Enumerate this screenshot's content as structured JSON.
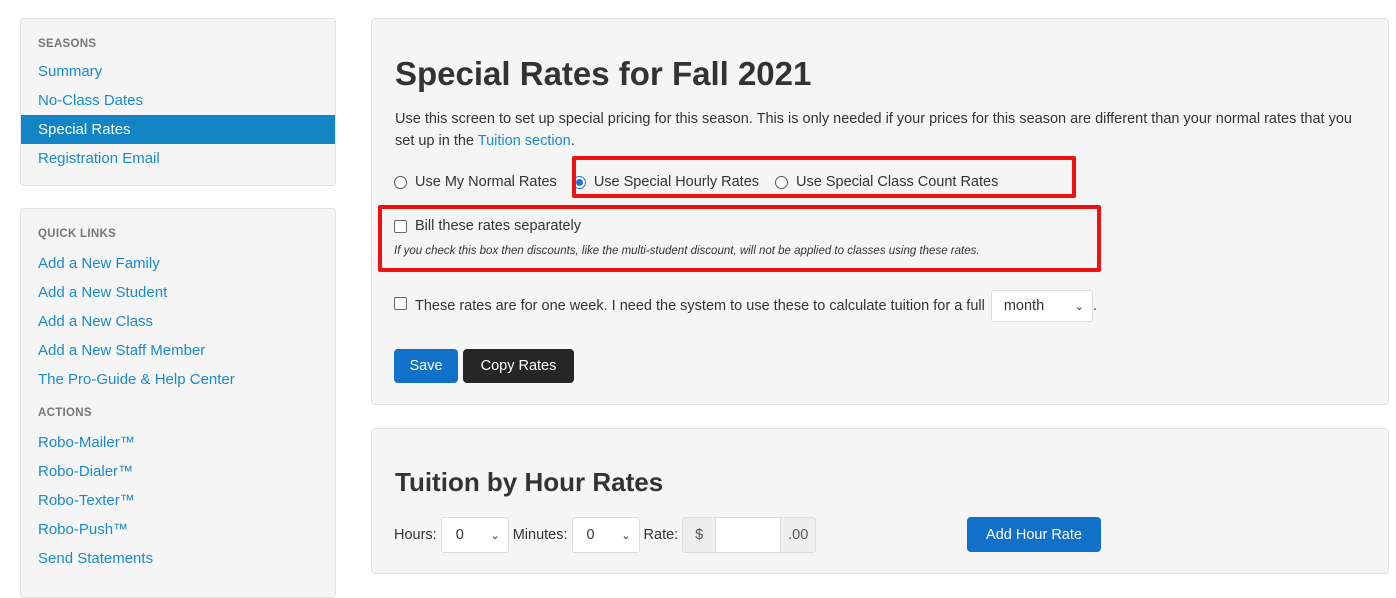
{
  "sidebar": {
    "seasons_heading": "SEASONS",
    "seasons_links": [
      "Summary",
      "No-Class Dates",
      "Special Rates",
      "Registration Email"
    ],
    "active_link": "Special Rates",
    "quick_links_heading": "QUICK LINKS",
    "quick_links": [
      "Add a New Family",
      "Add a New Student",
      "Add a New Class",
      "Add a New Staff Member",
      "The Pro-Guide & Help Center"
    ],
    "actions_heading": "ACTIONS",
    "actions": [
      "Robo-Mailer™",
      "Robo-Dialer™",
      "Robo-Texter™",
      "Robo-Push™",
      "Send Statements"
    ]
  },
  "main": {
    "title": "Special Rates for Fall 2021",
    "intro_text": "Use this screen to set up special pricing for this season. This is only needed if your prices for this season are different than your normal rates that you set up in the ",
    "intro_link": "Tuition section",
    "intro_end": ".",
    "rate_options": [
      {
        "label": "Use My Normal Rates",
        "checked": false
      },
      {
        "label": "Use Special Hourly Rates",
        "checked": true
      },
      {
        "label": "Use Special Class Count Rates",
        "checked": false
      }
    ],
    "bill_separately_label": "Bill these rates separately",
    "bill_separately_note": "If you check this box then discounts, like the multi-student discount, will not be applied to classes using these rates.",
    "week_label": "These rates are for one week. I need the system to use these to calculate tuition for a full",
    "week_period_value": "month",
    "week_end": ".",
    "save_label": "Save",
    "copy_label": "Copy Rates"
  },
  "tuition": {
    "title": "Tuition by Hour Rates",
    "hours_label": "Hours:",
    "hours_value": "0",
    "minutes_label": "Minutes:",
    "minutes_value": "0",
    "rate_label": "Rate:",
    "currency": "$",
    "cents": ".00",
    "add_button": "Add Hour Rate"
  },
  "colors": {
    "link": "#1a8ace",
    "active_bg": "#1384c4",
    "primary_button": "#1170c7",
    "dark_button": "#262626",
    "highlight": "#ee1111"
  }
}
